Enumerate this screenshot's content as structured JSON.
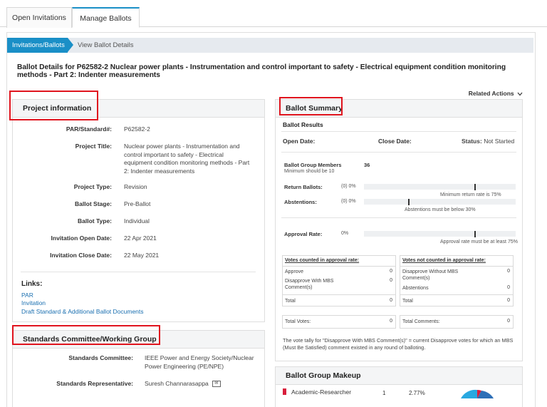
{
  "tabs": [
    {
      "label": "Open Invitations"
    },
    {
      "label": "Manage Ballots"
    }
  ],
  "breadcrumb": {
    "current": "Invitations/Ballots",
    "next": "View Ballot Details"
  },
  "ballot_title": "Ballot Details for P62582-2 Nuclear power plants - Instrumentation and control important to safety - Electrical equipment condition monitoring methods - Part 2: Indenter measurements",
  "related_actions": "Related Actions",
  "project": {
    "heading": "Project information",
    "fields": [
      {
        "label": "PAR/Standard#:",
        "value": "P62582-2"
      },
      {
        "label": "Project Title:",
        "value": "Nuclear power plants - Instrumentation and control important to safety - Electrical equipment condition monitoring methods - Part 2: Indenter measurements"
      },
      {
        "label": "Project Type:",
        "value": "Revision"
      },
      {
        "label": "Ballot Stage:",
        "value": "Pre-Ballot"
      },
      {
        "label": "Ballot Type:",
        "value": "Individual"
      },
      {
        "label": "Invitation Open Date:",
        "value": "22 Apr 2021"
      },
      {
        "label": "Invitation Close Date:",
        "value": "22 May 2021"
      }
    ],
    "links_title": "Links:",
    "links": [
      "PAR",
      "Invitation",
      "Draft Standard & Additional Ballot Documents"
    ]
  },
  "committee": {
    "heading": "Standards Committee/Working Group",
    "fields": [
      {
        "label": "Standards Committee:",
        "value": "IEEE Power and Energy Society/Nuclear Power Engineering (PE/NPE)"
      },
      {
        "label": "Standards Representative:",
        "value": "Suresh Channarasappa"
      }
    ]
  },
  "summary": {
    "heading": "Ballot Summary",
    "results_title": "Ballot Results",
    "open_date_label": "Open Date:",
    "close_date_label": "Close Date:",
    "status_label": "Status:",
    "status_value": "Not Started",
    "members_label": "Ballot Group Members",
    "members_value": "36",
    "members_note": "Minimum should be 10",
    "return_label": "Return Ballots:",
    "return_value": "(0) 0%",
    "return_fraction": 0,
    "return_note": "Minimum return rate is 75%",
    "abst_label": "Abstentions:",
    "abst_value": "(0) 0%",
    "abst_fraction": 0,
    "abst_note": "Abstentions must be below 30%",
    "approval_label": "Approval Rate:",
    "approval_value": "0%",
    "approval_fraction": 0,
    "approval_note": "Approval rate must be at least 75%",
    "counted_title": "Votes counted in approval rate:",
    "counted": [
      {
        "label": "Approve",
        "value": "0"
      },
      {
        "label": "Disapprove With MBS Comment(s)",
        "value": "0"
      },
      {
        "label": "Total",
        "value": "0"
      }
    ],
    "not_counted_title": "Votes not counted in approval rate:",
    "not_counted": [
      {
        "label": "Disapprove Without MBS Comment(s)",
        "value": "0"
      },
      {
        "label": "Abstentions",
        "value": "0"
      },
      {
        "label": "Total",
        "value": "0"
      }
    ],
    "total_votes_label": "Total Votes:",
    "total_votes_value": "0",
    "total_comments_label": "Total Comments:",
    "total_comments_value": "0",
    "footnote": "The vote tally for \"Disapprove With MBS Comment(s)\" = current Disapprove votes for which an MBS (Must Be Satisfied) comment existed in any round of balloting."
  },
  "makeup": {
    "heading": "Ballot Group Makeup",
    "rows": [
      {
        "label": "Academic-Researcher",
        "count": "1",
        "percent": "2.77%"
      }
    ]
  }
}
